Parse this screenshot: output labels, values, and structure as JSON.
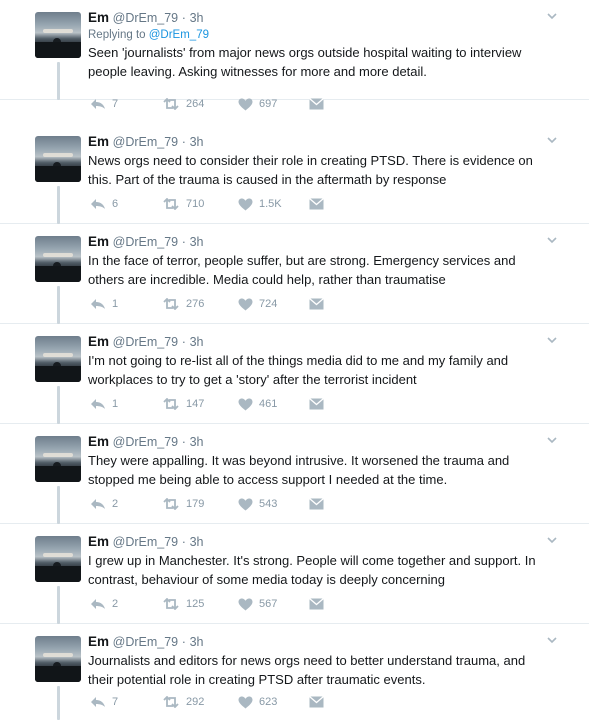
{
  "thread": {
    "tweets": [
      {
        "author": "Em",
        "handle": "@DrEm_79",
        "separator": "·",
        "time": "3h",
        "replying_prefix": "Replying to",
        "replying_to": "@DrEm_79",
        "text": "Seen 'journalists' from major news orgs outside hospital waiting to interview people leaving. Asking witnesses for more and more detail.",
        "replies": "7",
        "retweets": "264",
        "likes": "697"
      },
      {
        "author": "Em",
        "handle": "@DrEm_79",
        "separator": "·",
        "time": "3h",
        "text": "News orgs need to consider their role in creating PTSD. There is evidence on this. Part of the trauma is caused in the aftermath by response",
        "replies": "6",
        "retweets": "710",
        "likes": "1.5K"
      },
      {
        "author": "Em",
        "handle": "@DrEm_79",
        "separator": "·",
        "time": "3h",
        "text": "In the face of terror, people suffer, but are strong. Emergency services and others are incredible. Media could help, rather than traumatise",
        "replies": "1",
        "retweets": "276",
        "likes": "724"
      },
      {
        "author": "Em",
        "handle": "@DrEm_79",
        "separator": "·",
        "time": "3h",
        "text": "I'm not going to re-list all of the things media did to me and my family and workplaces to try to get a 'story' after the terrorist incident",
        "replies": "1",
        "retweets": "147",
        "likes": "461"
      },
      {
        "author": "Em",
        "handle": "@DrEm_79",
        "separator": "·",
        "time": "3h",
        "text": "They were appalling. It was beyond intrusive. It worsened the trauma and stopped me being able to access support I needed at the time.",
        "replies": "2",
        "retweets": "179",
        "likes": "543"
      },
      {
        "author": "Em",
        "handle": "@DrEm_79",
        "separator": "·",
        "time": "3h",
        "text": "I grew up in Manchester. It's strong. People will come together and support. In contrast, behaviour of some media today is deeply concerning",
        "replies": "2",
        "retweets": "125",
        "likes": "567"
      },
      {
        "author": "Em",
        "handle": "@DrEm_79",
        "separator": "·",
        "time": "3h",
        "text": "Journalists and editors for news orgs need to better understand trauma, and their potential role in creating PTSD after traumatic events.",
        "replies": "7",
        "retweets": "292",
        "likes": "623"
      }
    ]
  },
  "icons": {
    "reply": "reply-icon",
    "retweet": "retweet-icon",
    "like": "heart-icon",
    "message": "direct-message-icon",
    "menu": "chevron-down-icon"
  },
  "colors": {
    "text": "#14171a",
    "muted": "#657786",
    "action": "#aab8c2",
    "link": "#1b95e0",
    "thread_line": "#ccd6dd"
  }
}
